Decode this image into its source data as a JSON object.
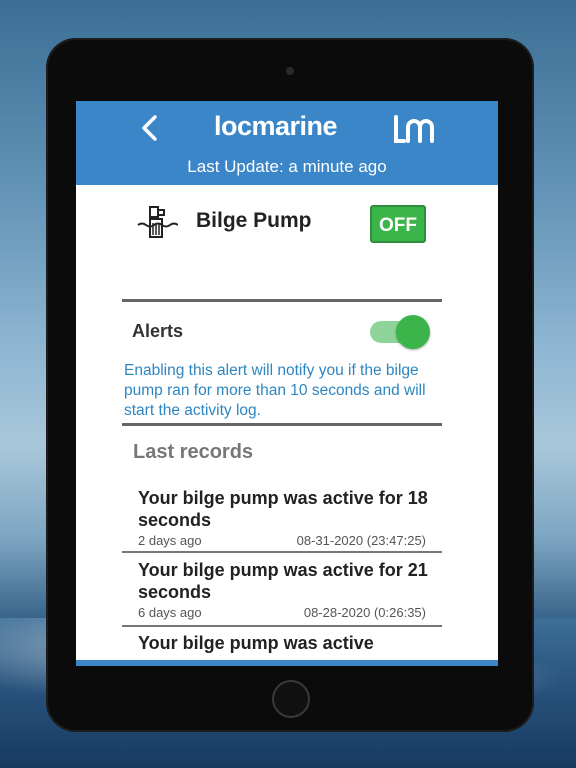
{
  "app": {
    "brand": "locmarine",
    "last_update": "Last Update: a minute ago"
  },
  "pump": {
    "title": "Bilge Pump",
    "status_label": "OFF"
  },
  "alerts": {
    "label": "Alerts",
    "enabled": true,
    "description": "Enabling this alert will notify you if the bilge pump ran for more than 10 seconds and will start the activity log."
  },
  "records": {
    "title": "Last records",
    "items": [
      {
        "text": "Your bilge pump was active for 18 seconds",
        "ago": "2 days ago",
        "date": "08-31-2020 (23:47:25)"
      },
      {
        "text": "Your bilge pump was active for 21 seconds",
        "ago": "6 days ago",
        "date": "08-28-2020 (0:26:35)"
      },
      {
        "text": "Your bilge pump was active",
        "ago": "",
        "date": ""
      }
    ]
  },
  "nav": {
    "items": [
      "dashboard-icon",
      "location-pin-icon",
      "alert-triangle-icon",
      "gear-icon"
    ]
  },
  "colors": {
    "header": "#3a86c8",
    "accent_green": "#3bb44a",
    "link_blue": "#2e86c1"
  }
}
